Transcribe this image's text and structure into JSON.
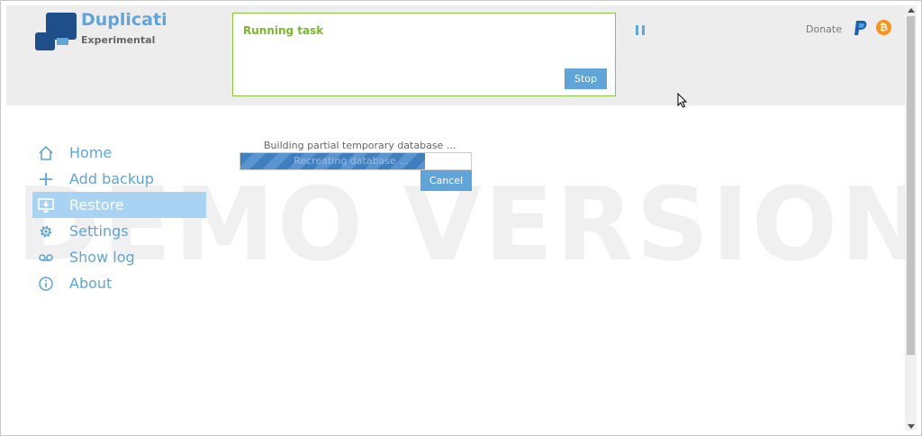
{
  "app": {
    "name": "Duplicati",
    "subtitle": "Experimental"
  },
  "task": {
    "title": "Running task",
    "stop_label": "Stop"
  },
  "header_right": {
    "donate_label": "Donate",
    "bitcoin_glyph": "₿"
  },
  "sidebar": {
    "items": [
      {
        "label": "Home",
        "icon": "home-icon",
        "active": false
      },
      {
        "label": "Add backup",
        "icon": "plus-icon",
        "active": false
      },
      {
        "label": "Restore",
        "icon": "restore-icon",
        "active": true
      },
      {
        "label": "Settings",
        "icon": "gear-icon",
        "active": false
      },
      {
        "label": "Show log",
        "icon": "log-icon",
        "active": false
      },
      {
        "label": "About",
        "icon": "info-icon",
        "active": false
      }
    ]
  },
  "progress": {
    "status_text": "Building partial temporary database ...",
    "bar_label": "Recreating database ...",
    "fraction": 0.8,
    "cancel_label": "Cancel"
  },
  "watermark": "DEMO VERSION",
  "colors": {
    "accent": "#5fa5d9",
    "task_border": "#8cc63f",
    "task_title": "#7ab929",
    "header_bg": "#ededed",
    "active_item_bg": "#a9d3f3"
  }
}
